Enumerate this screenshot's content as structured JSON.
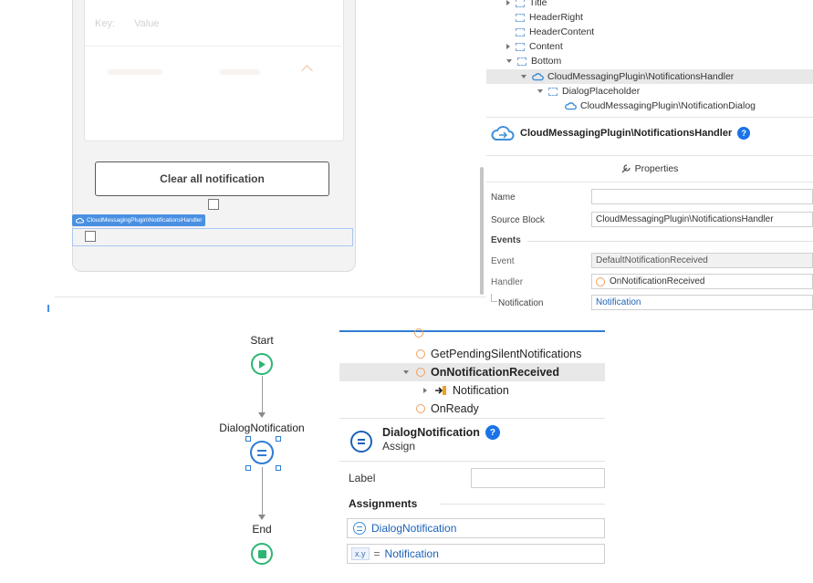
{
  "preview": {
    "key_label": "Key:",
    "value_label": "Value",
    "clear_button": "Clear all notification",
    "placeholder_tag": "CloudMessagingPlugin\\NotificationsHandler"
  },
  "tree": {
    "items": [
      {
        "label": "Title"
      },
      {
        "label": "HeaderRight"
      },
      {
        "label": "HeaderContent"
      },
      {
        "label": "Content"
      },
      {
        "label": "Bottom"
      },
      {
        "label": "CloudMessagingPlugin\\NotificationsHandler"
      },
      {
        "label": "DialogPlaceholder"
      },
      {
        "label": "CloudMessagingPlugin\\NotificationDialog"
      }
    ]
  },
  "properties": {
    "header_title": "CloudMessagingPlugin\\NotificationsHandler",
    "tab_label": "Properties",
    "name_label": "Name",
    "name_value": "",
    "source_block_label": "Source Block",
    "source_block_value": "CloudMessagingPlugin\\NotificationsHandler",
    "events_section": "Events",
    "event_label": "Event",
    "event_value": "DefaultNotificationReceived",
    "handler_label": "Handler",
    "handler_value": "OnNotificationReceived",
    "notification_label": "Notification",
    "notification_value": "Notification"
  },
  "flow": {
    "start": "Start",
    "assign": "DialogNotification",
    "end": "End"
  },
  "action_tree": {
    "items": [
      {
        "label": "GetPendingSilentNotifications"
      },
      {
        "label": "OnNotificationReceived"
      },
      {
        "label": "Notification"
      },
      {
        "label": "OnReady"
      }
    ]
  },
  "assign_panel": {
    "title": "DialogNotification",
    "subtitle": "Assign",
    "label_label": "Label",
    "label_value": "",
    "assignments_section": "Assignments",
    "variable": "DialogNotification",
    "xy_tag": "x.y",
    "equals": "=",
    "value": "Notification"
  },
  "colors": {
    "accent_blue": "#1a73e8",
    "flow_green": "#2bb673",
    "orange": "#f0a05c"
  }
}
